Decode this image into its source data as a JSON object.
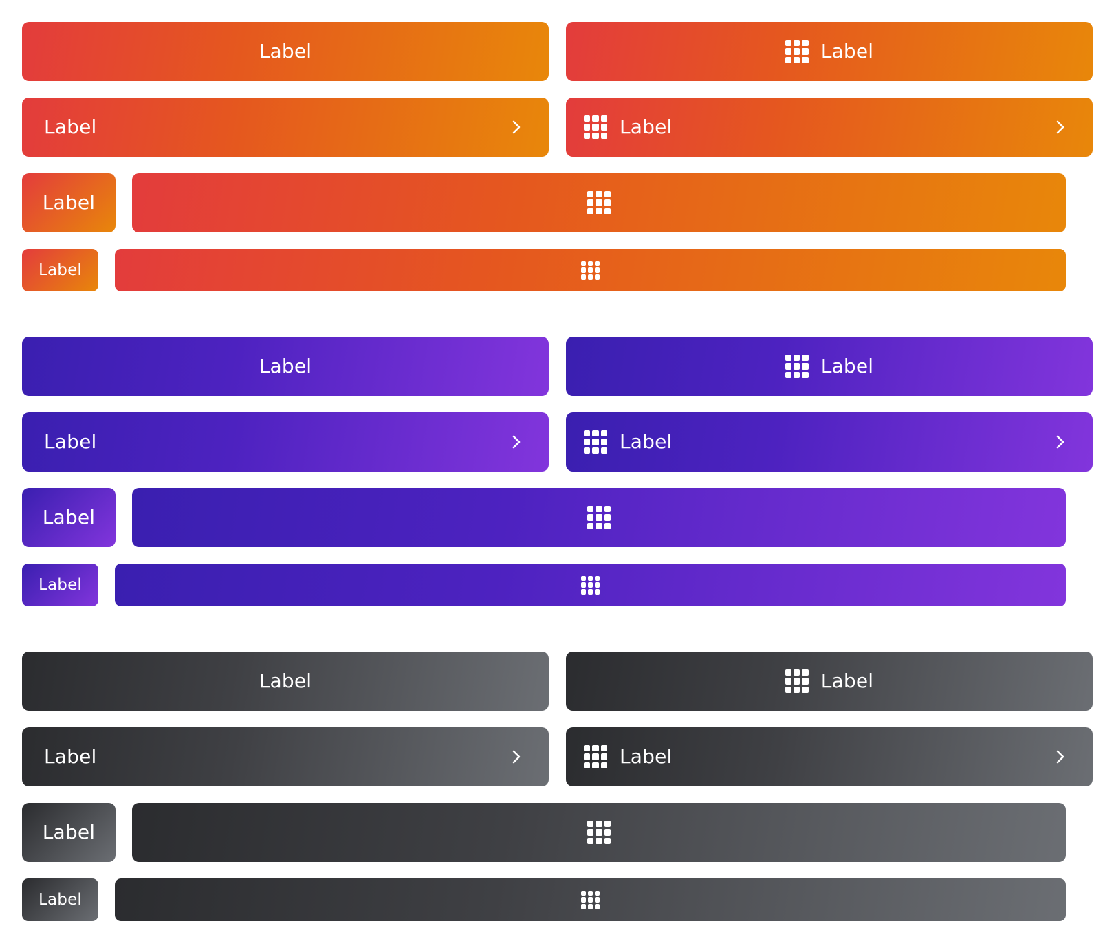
{
  "themes": {
    "orange": {
      "start": "#e33c3c",
      "end": "#e8870a"
    },
    "purple": {
      "start": "#3a1fb0",
      "end": "#8235dc"
    },
    "dark": {
      "start": "#2b2c2f",
      "end": "#6b6e73"
    }
  },
  "icons": {
    "grid": "grid-icon",
    "chevron": "chevron-right-icon"
  },
  "groups": [
    {
      "name": "orange",
      "buttons": {
        "full_center": "Label",
        "icon_center": "Label",
        "full_chevron": "Label",
        "icon_chevron": "Label",
        "compact": "Label",
        "small": "Label"
      }
    },
    {
      "name": "purple",
      "buttons": {
        "full_center": "Label",
        "icon_center": "Label",
        "full_chevron": "Label",
        "icon_chevron": "Label",
        "compact": "Label",
        "small": "Label"
      }
    },
    {
      "name": "dark",
      "buttons": {
        "full_center": "Label",
        "icon_center": "Label",
        "full_chevron": "Label",
        "icon_chevron": "Label",
        "compact": "Label",
        "small": "Label"
      }
    }
  ]
}
